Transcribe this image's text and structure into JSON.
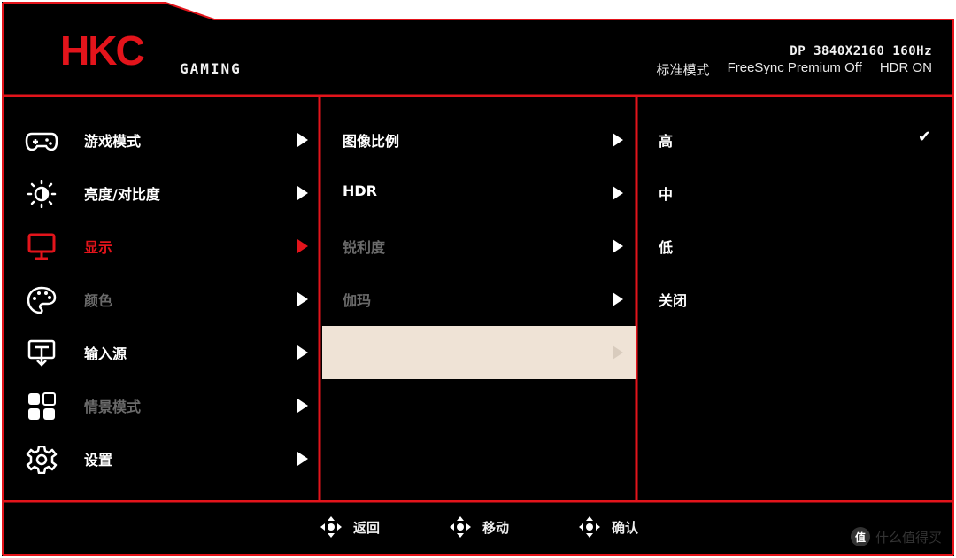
{
  "header": {
    "brand": "HKC",
    "subtitle": "GAMING",
    "signal": "DP 3840X2160 160Hz",
    "status": [
      "标准模式",
      "FreeSync Premium Off",
      "HDR ON"
    ]
  },
  "colors": {
    "accent": "#e3141b",
    "highlight": "#efe3d6",
    "dim": "#6a6a6a"
  },
  "main_menu": [
    {
      "label": "游戏模式",
      "icon": "gamepad-icon",
      "state": "normal"
    },
    {
      "label": "亮度/对比度",
      "icon": "brightness-icon",
      "state": "normal"
    },
    {
      "label": "显示",
      "icon": "monitor-icon",
      "state": "active"
    },
    {
      "label": "颜色",
      "icon": "palette-icon",
      "state": "dim"
    },
    {
      "label": "输入源",
      "icon": "input-source-icon",
      "state": "normal"
    },
    {
      "label": "情景模式",
      "icon": "scene-mode-icon",
      "state": "dim"
    },
    {
      "label": "设置",
      "icon": "gear-icon",
      "state": "normal"
    }
  ],
  "sub_menu": [
    {
      "label": "图像比例",
      "state": "normal"
    },
    {
      "label": "HDR",
      "state": "normal"
    },
    {
      "label": "锐利度",
      "state": "dim"
    },
    {
      "label": "伽玛",
      "state": "dim"
    },
    {
      "label": "",
      "state": "highlight"
    }
  ],
  "options": [
    {
      "label": "高",
      "selected": true
    },
    {
      "label": "中",
      "selected": false
    },
    {
      "label": "低",
      "selected": false
    },
    {
      "label": "关闭",
      "selected": false
    }
  ],
  "check_mark": "✔",
  "footer": [
    {
      "label": "返回",
      "icon": "dpad-icon"
    },
    {
      "label": "移动",
      "icon": "dpad-icon"
    },
    {
      "label": "确认",
      "icon": "dpad-icon"
    }
  ],
  "watermark": {
    "badge": "值",
    "text": "什么值得买"
  }
}
